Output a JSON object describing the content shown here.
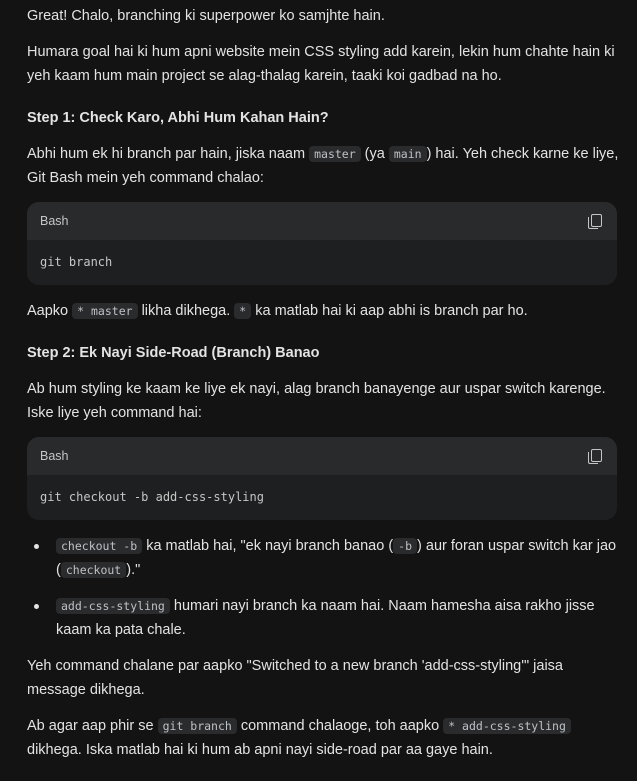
{
  "intro": "Great! Chalo, branching ki superpower ko samjhte hain.",
  "goal": "Humara goal hai ki hum apni website mein CSS styling add karein, lekin hum chahte hain ki yeh kaam hum main project se alag-thalag karein, taaki koi gadbad na ho.",
  "step1": {
    "heading": "Step 1: Check Karo, Abhi Hum Kahan Hain?",
    "p1_a": "Abhi hum ek hi branch par hain, jiska naam ",
    "p1_code1": "master",
    "p1_b": " (ya ",
    "p1_code2": "main",
    "p1_c": ") hai. Yeh check karne ke liye, Git Bash mein yeh command chalao:",
    "code_lang": "Bash",
    "code": "git branch",
    "after_a": "Aapko ",
    "after_code1": "* master",
    "after_b": " likha dikhega. ",
    "after_code2": "*",
    "after_c": " ka matlab hai ki aap abhi is branch par ho."
  },
  "step2": {
    "heading": "Step 2: Ek Nayi Side-Road (Branch) Banao",
    "p1": "Ab hum styling ke kaam ke liye ek nayi, alag branch banayenge aur uspar switch karenge. Iske liye yeh command hai:",
    "code_lang": "Bash",
    "code": "git checkout -b add-css-styling",
    "bullet1_code": "checkout -b",
    "bullet1_a": " ka matlab hai, \"ek nayi branch banao (",
    "bullet1_code2": "-b",
    "bullet1_b": ") aur foran uspar switch kar jao (",
    "bullet1_code3": "checkout",
    "bullet1_c": ").\"",
    "bullet2_code": "add-css-styling",
    "bullet2_a": " humari nayi branch ka naam hai. Naam hamesha aisa rakho jisse kaam ka pata chale.",
    "p2": "Yeh command chalane par aapko \"Switched to a new branch 'add-css-styling'\" jaisa message dikhega.",
    "p3_a": "Ab agar aap phir se ",
    "p3_code1": "git branch",
    "p3_b": " command chalaoge, toh aapko ",
    "p3_code2": "* add-css-styling",
    "p3_c": " dikhega. Iska matlab hai ki hum ab apni nayi side-road par aa gaye hain."
  },
  "icons": {
    "copy": "copy-icon"
  }
}
